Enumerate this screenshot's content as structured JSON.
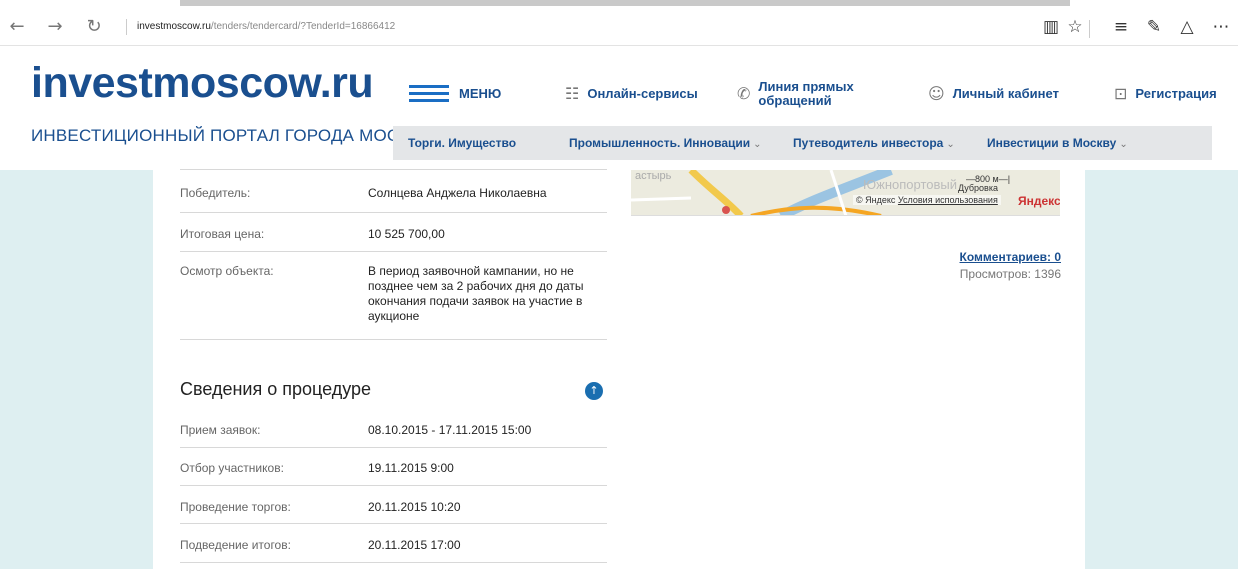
{
  "browser": {
    "url_host": "investmoscow.ru",
    "url_path": "/tenders/tendercard/?TenderId=16866412"
  },
  "site": {
    "logo_part1": "invest",
    "logo_part2": "moscow.ru",
    "tagline": "ИНВЕСТИЦИОННЫЙ ПОРТАЛ ГОРОДА МОСКВЫ"
  },
  "topnav": {
    "menu": "МЕНЮ",
    "online": "Онлайн-сервисы",
    "hotline": "Линия прямых обращений",
    "cabinet": "Личный кабинет",
    "register": "Регистрация"
  },
  "subnav": [
    "Торги. Имущество",
    "Промышленность. Инновации",
    "Путеводитель инвестора",
    "Инвестиции в Москву"
  ],
  "details": [
    {
      "label": "Победитель:",
      "value": "Солнцева Анджела Николаевна"
    },
    {
      "label": "Итоговая цена:",
      "value": "10 525 700,00"
    },
    {
      "label": "Осмотр объекта:",
      "value": "В период заявочной кампании, но не позднее чем за 2 рабочих дня до даты окончания подачи заявок на участие в аукционе"
    }
  ],
  "procedure": {
    "title": "Сведения о процедуре",
    "rows": [
      {
        "label": "Прием заявок:",
        "value": "08.10.2015 - 17.11.2015 15:00"
      },
      {
        "label": "Отбор участников:",
        "value": "19.11.2015 9:00"
      },
      {
        "label": "Проведение торгов:",
        "value": "20.11.2015 10:20"
      },
      {
        "label": "Подведение итогов:",
        "value": "20.11.2015 17:00"
      }
    ]
  },
  "map": {
    "label_district": "Южнопортовый",
    "label_dubrovka": "Дубровка",
    "label_partial": "астырь",
    "scale": "800 м",
    "credit": "© Яндекс",
    "terms": "Условия использования",
    "brand": "Яндекс"
  },
  "sidebar": {
    "comments": "Комментариев: 0",
    "views": "Просмотров: 1396"
  },
  "colors": {
    "brand_blue": "#1a4f8f",
    "page_band": "#deeff1"
  }
}
